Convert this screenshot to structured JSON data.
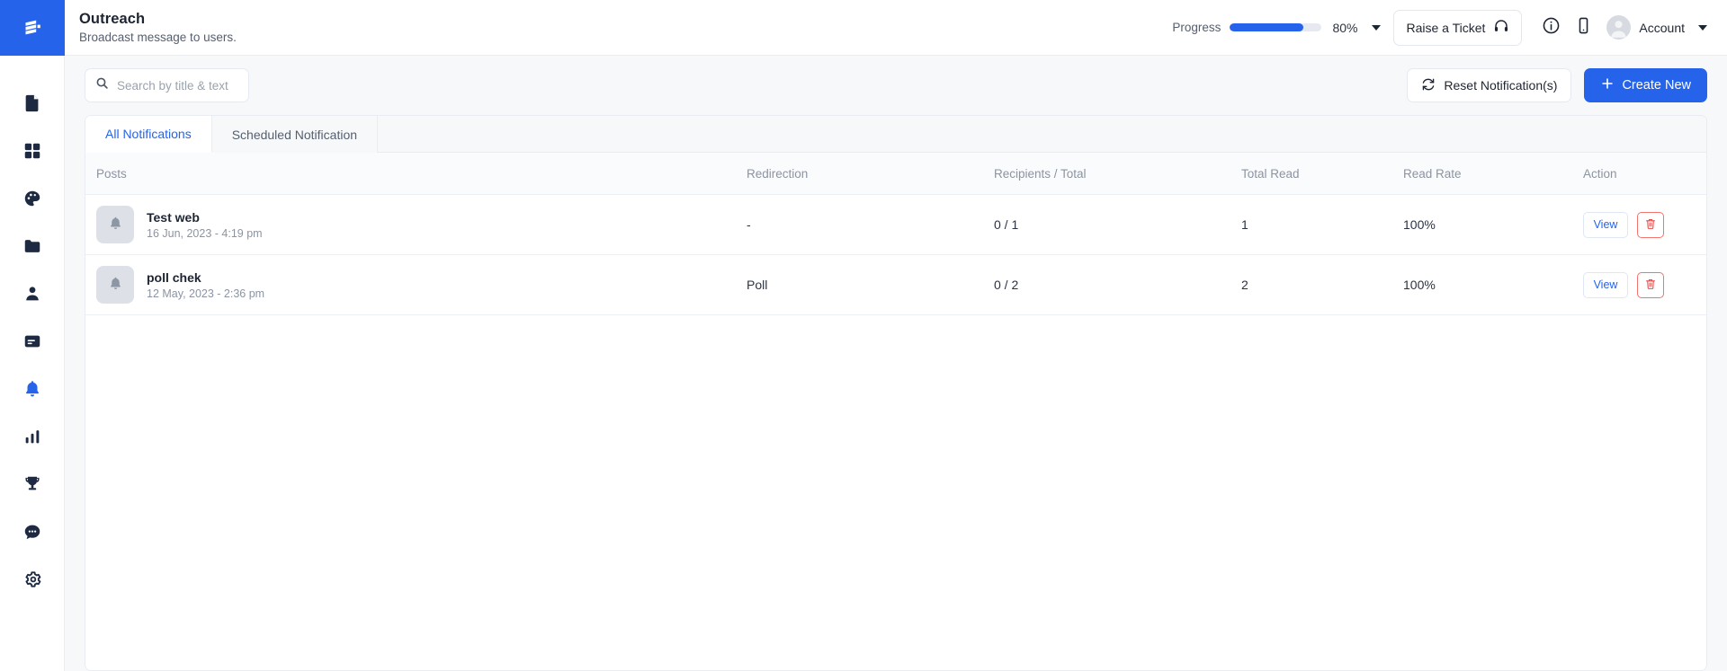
{
  "sidebar": {
    "logo_name": "platform-logo",
    "items": [
      {
        "icon": "document-icon",
        "name": "sidebar-item-documents",
        "active": false
      },
      {
        "icon": "grid-icon",
        "name": "sidebar-item-dashboard",
        "active": false
      },
      {
        "icon": "palette-icon",
        "name": "sidebar-item-appearance",
        "active": false
      },
      {
        "icon": "folder-icon",
        "name": "sidebar-item-files",
        "active": false
      },
      {
        "icon": "user-icon",
        "name": "sidebar-item-users",
        "active": false
      },
      {
        "icon": "card-icon",
        "name": "sidebar-item-content",
        "active": false
      },
      {
        "icon": "bell-icon",
        "name": "sidebar-item-notifications",
        "active": true
      },
      {
        "icon": "bar-chart-icon",
        "name": "sidebar-item-analytics",
        "active": false
      },
      {
        "icon": "trophy-icon",
        "name": "sidebar-item-rewards",
        "active": false
      },
      {
        "icon": "chat-icon",
        "name": "sidebar-item-messages",
        "active": false
      },
      {
        "icon": "gear-icon",
        "name": "sidebar-item-settings",
        "active": false
      }
    ]
  },
  "header": {
    "title": "Outreach",
    "subtitle": "Broadcast message to users.",
    "progress_label": "Progress",
    "progress_value": "80%",
    "progress_percent": 80,
    "ticket_button": "Raise a Ticket",
    "account_label": "Account",
    "info_icon": "info-circle-icon",
    "mobile_icon": "mobile-phone-icon",
    "headset_icon": "headset-icon",
    "accent_color": "#2563eb"
  },
  "toolbar": {
    "search_placeholder": "Search by title & text",
    "search_value": "",
    "reset_label": "Reset Notification(s)",
    "create_label": "Create New"
  },
  "tabs": [
    {
      "label": "All Notifications",
      "active": true
    },
    {
      "label": "Scheduled Notification",
      "active": false
    }
  ],
  "table": {
    "columns": [
      "Posts",
      "Redirection",
      "Recipients / Total",
      "Total Read",
      "Read Rate",
      "Action"
    ],
    "rows": [
      {
        "title": "Test web",
        "date": "16 Jun, 2023 - 4:19 pm",
        "redirection": "-",
        "recipients": "0 / 1",
        "total_read": "1",
        "read_rate": "100%",
        "view_label": "View",
        "delete_icon": "trash-icon"
      },
      {
        "title": "poll chek",
        "date": "12 May, 2023 - 2:36 pm",
        "redirection": "Poll",
        "recipients": "0 / 2",
        "total_read": "2",
        "read_rate": "100%",
        "view_label": "View",
        "delete_icon": "trash-icon"
      }
    ]
  }
}
